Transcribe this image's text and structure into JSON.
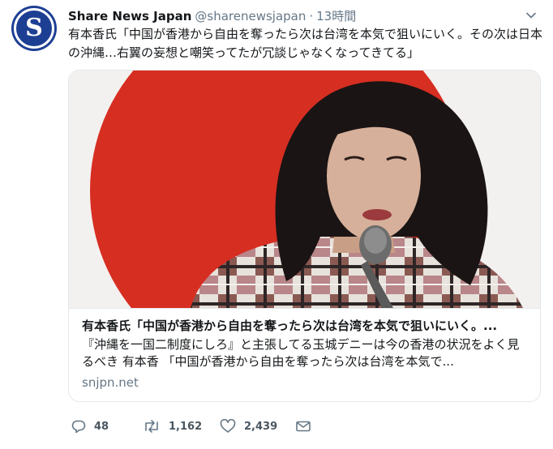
{
  "tweet": {
    "avatar_letter": "S",
    "display_name": "Share News Japan",
    "handle": "@sharenewsjapan",
    "separator": "·",
    "time": "13時間",
    "text": "有本香氏「中国が香港から自由を奪ったら次は台湾を本気で狙いにいく。その次は日本の沖縄…右翼の妄想と嘲笑ってたが冗談じゃなくなってきてる」"
  },
  "card": {
    "title": "有本香氏「中国が香港から自由を奪ったら次は台湾を本気で狙いにいく。...",
    "description": "『沖縄を一国二制度にしろ』と主張してる玉城デニーは今の香港の状況をよく見るべき 有本香 「中国が香港から自由を奪ったら次は台湾を本気で...",
    "domain": "snjpn.net"
  },
  "actions": {
    "reply_count": "48",
    "retweet_count": "1,162",
    "like_count": "2,439"
  },
  "icons": [
    "caret-down-icon",
    "reply-icon",
    "retweet-icon",
    "like-icon",
    "message-icon"
  ],
  "colors": {
    "avatar_bg": "#1d3f93",
    "text": "#14171a",
    "muted": "#657786",
    "border": "#e1e8ed",
    "flag_red": "#d72e22"
  }
}
